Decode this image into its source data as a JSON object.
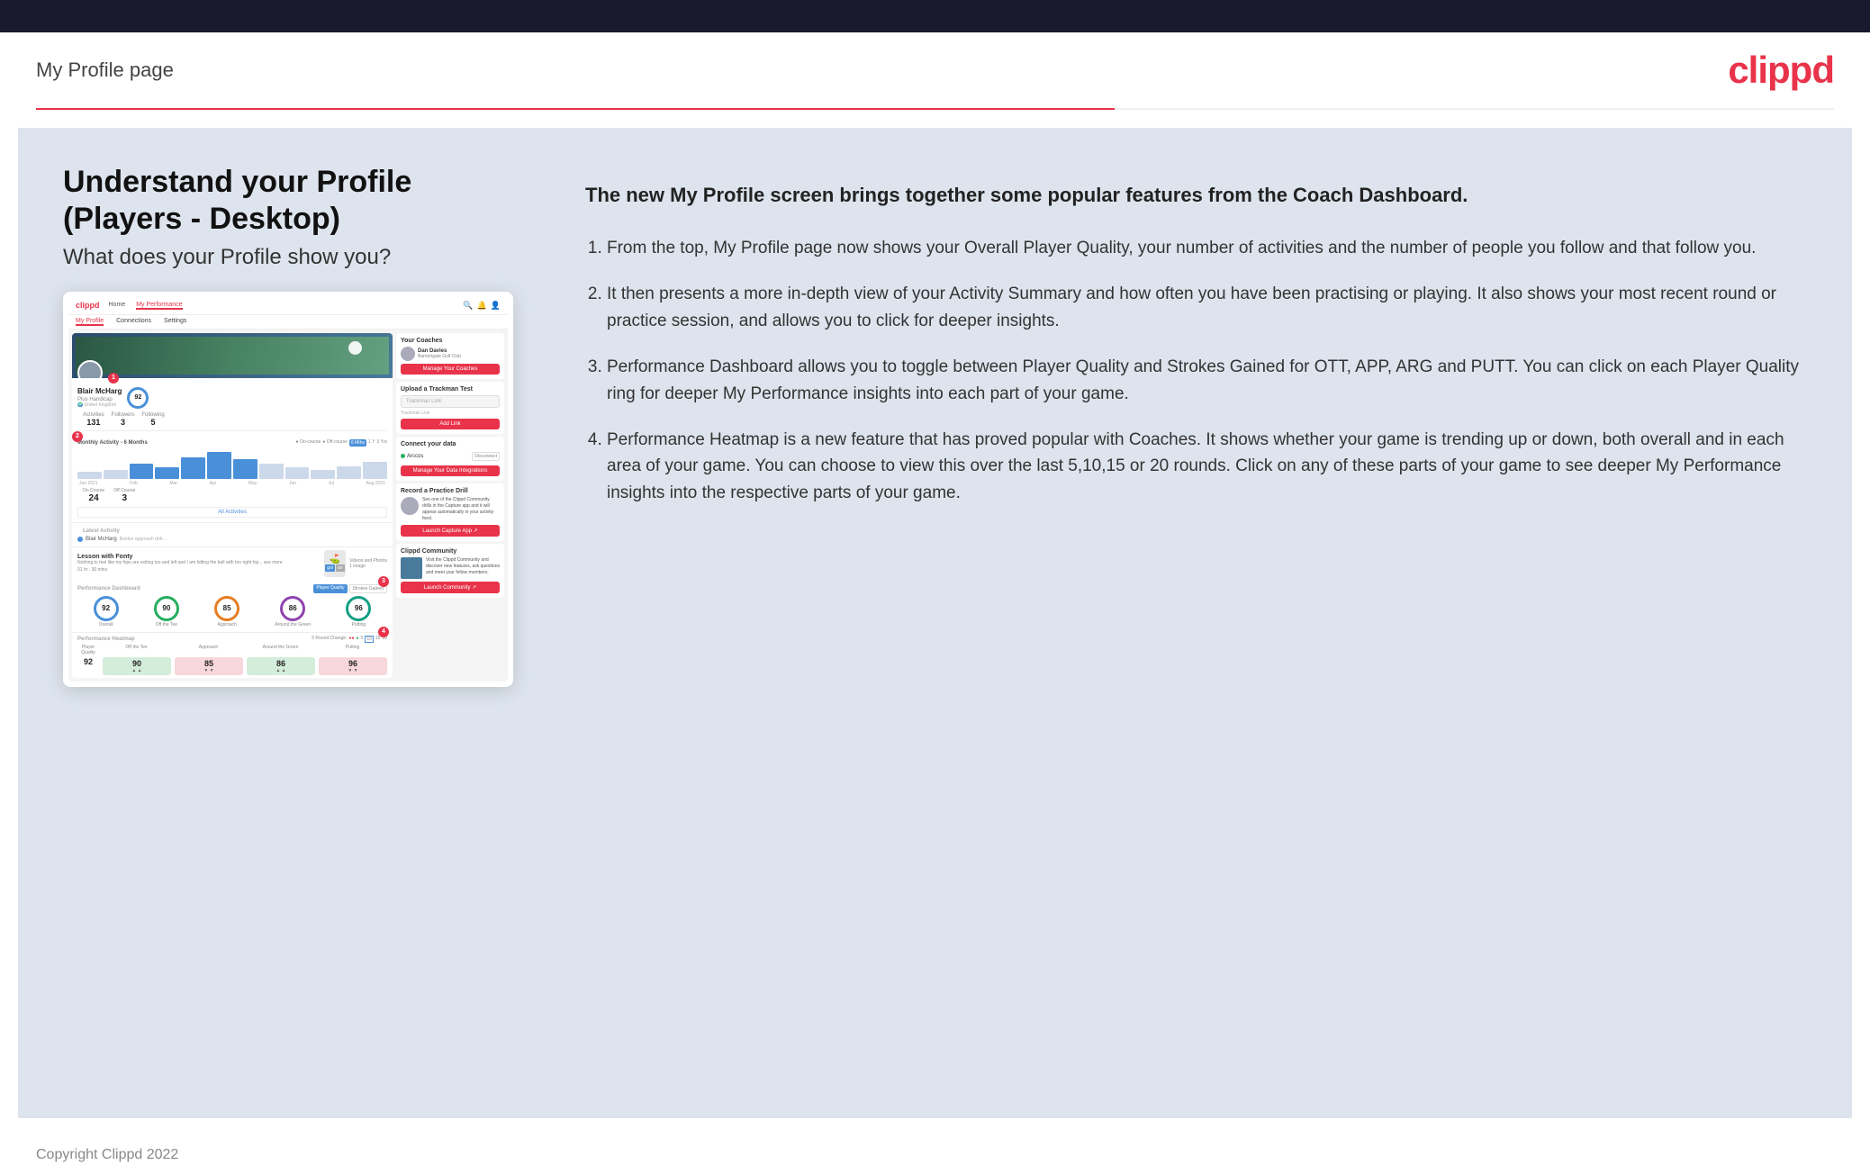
{
  "header": {
    "title": "My Profile page",
    "logo": "clippd"
  },
  "main": {
    "heading": "Understand your Profile (Players - Desktop)",
    "subheading": "What does your Profile show you?",
    "intro": "The new My Profile screen brings together some popular features from the Coach Dashboard.",
    "features": [
      "From the top, My Profile page now shows your Overall Player Quality, your number of activities and the number of people you follow and that follow you.",
      "It then presents a more in-depth view of your Activity Summary and how often you have been practising or playing. It also shows your most recent round or practice session, and allows you to click for deeper insights.",
      "Performance Dashboard allows you to toggle between Player Quality and Strokes Gained for OTT, APP, ARG and PUTT. You can click on each Player Quality ring for deeper My Performance insights into each part of your game.",
      "Performance Heatmap is a new feature that has proved popular with Coaches. It shows whether your game is trending up or down, both overall and in each area of your game. You can choose to view this over the last 5,10,15 or 20 rounds. Click on any of these parts of your game to see deeper My Performance insights into the respective parts of your game."
    ]
  },
  "app_mockup": {
    "nav": {
      "logo": "clippd",
      "items": [
        "Home",
        "My Performance"
      ],
      "active": "My Performance",
      "sub_items": [
        "My Profile",
        "Connections",
        "Settings"
      ],
      "sub_active": "My Profile"
    },
    "profile": {
      "name": "Blair McHarg",
      "handicap": "Plus Handicap",
      "location": "United Kingdom",
      "quality": "92",
      "activities": "131",
      "followers": "3",
      "following": "5"
    },
    "activity": {
      "title": "Monthly Activity - 6 Months",
      "on_course": "24",
      "off_course": "3",
      "bars": [
        6,
        8,
        14,
        10,
        20,
        25,
        18,
        14,
        10,
        8,
        12,
        16
      ]
    },
    "performance": {
      "overall": "92",
      "off_tee": "90",
      "approach": "85",
      "around_green": "86",
      "putting": "96"
    },
    "heatmap": {
      "overall": "92",
      "off_tee": "90",
      "approach": "85",
      "around_green": "86",
      "putting": "96"
    },
    "coaches": {
      "title": "Your Coaches",
      "name": "Dan Davies",
      "club": "Barnehgate Golf Club"
    },
    "trackman": {
      "title": "Upload a Trackman Test",
      "placeholder": "Trackman Link"
    },
    "data_connect": {
      "title": "Connect your data",
      "service": "Arccos",
      "button": "Manage Your Data Integrations"
    },
    "drill": {
      "title": "Record a Practice Drill",
      "description": "See one of the Clippd Community drills in the Capture app and it will appear automatically in your activity feed."
    },
    "community": {
      "title": "Clippd Community",
      "description": "Visit the Clippd Community and discover new features, ask questions and meet your fellow members."
    }
  },
  "footer": {
    "copyright": "Copyright Clippd 2022"
  }
}
